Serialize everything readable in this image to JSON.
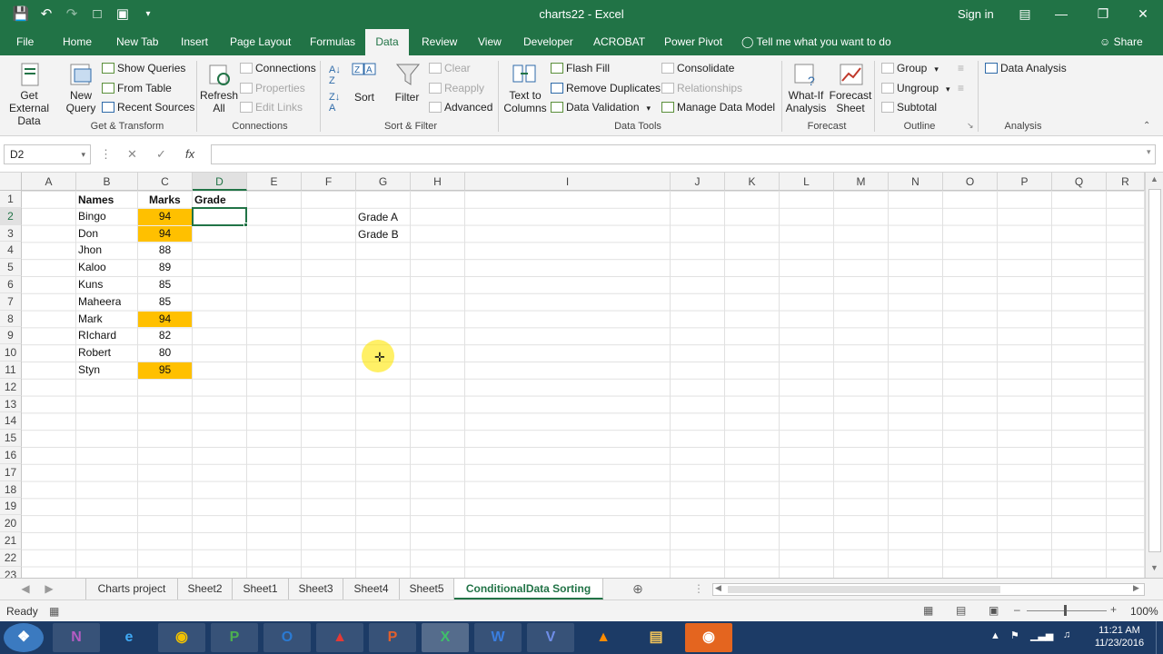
{
  "window": {
    "title": "charts22  -  Excel",
    "sign_in": "Sign in"
  },
  "ribbon_tabs": [
    {
      "label": "File"
    },
    {
      "label": "Home"
    },
    {
      "label": "New Tab"
    },
    {
      "label": "Insert"
    },
    {
      "label": "Page Layout"
    },
    {
      "label": "Formulas"
    },
    {
      "label": "Data"
    },
    {
      "label": "Review"
    },
    {
      "label": "View"
    },
    {
      "label": "Developer"
    },
    {
      "label": "ACROBAT"
    },
    {
      "label": "Power Pivot"
    }
  ],
  "active_tab": "Data",
  "tell_me": "Tell me what you want to do",
  "share": "Share",
  "ribbon": {
    "get_external_data": "Get External\nData",
    "new_query": "New\nQuery",
    "show_queries": "Show Queries",
    "from_table": "From Table",
    "recent_sources": "Recent Sources",
    "group_get_transform": "Get & Transform",
    "refresh_all": "Refresh\nAll",
    "connections": "Connections",
    "properties": "Properties",
    "edit_links": "Edit Links",
    "group_connections": "Connections",
    "sort": "Sort",
    "filter": "Filter",
    "clear": "Clear",
    "reapply": "Reapply",
    "advanced": "Advanced",
    "group_sort_filter": "Sort & Filter",
    "text_to_columns": "Text to\nColumns",
    "flash_fill": "Flash Fill",
    "remove_duplicates": "Remove Duplicates",
    "data_validation": "Data Validation",
    "consolidate": "Consolidate",
    "relationships": "Relationships",
    "manage_data_model": "Manage Data Model",
    "group_data_tools": "Data Tools",
    "what_if": "What-If\nAnalysis",
    "forecast_sheet": "Forecast\nSheet",
    "group_forecast": "Forecast",
    "group": "Group",
    "ungroup": "Ungroup",
    "subtotal": "Subtotal",
    "group_outline": "Outline",
    "data_analysis": "Data Analysis",
    "group_analysis": "Analysis"
  },
  "formula_bar": {
    "name_box": "D2",
    "fx": "fx",
    "value": ""
  },
  "columns": [
    "A",
    "B",
    "C",
    "D",
    "E",
    "F",
    "G",
    "H",
    "I",
    "J",
    "K",
    "L",
    "M",
    "N",
    "O",
    "P",
    "Q",
    "R"
  ],
  "rows": [
    "1",
    "2",
    "3",
    "4",
    "5",
    "6",
    "7",
    "8",
    "9",
    "10",
    "11",
    "12",
    "13",
    "14",
    "15",
    "16",
    "17",
    "18",
    "19",
    "20",
    "21",
    "22",
    "23"
  ],
  "table": {
    "header_names": "Names",
    "header_marks": "Marks",
    "header_grade": "Grade",
    "entries": [
      {
        "name": "Bingo",
        "marks": "94"
      },
      {
        "name": "Don",
        "marks": "94"
      },
      {
        "name": "Jhon",
        "marks": "88"
      },
      {
        "name": "Kaloo",
        "marks": "89"
      },
      {
        "name": "Kuns",
        "marks": "85"
      },
      {
        "name": "Maheera",
        "marks": "85"
      },
      {
        "name": "Mark",
        "marks": "94"
      },
      {
        "name": "RIchard",
        "marks": "82"
      },
      {
        "name": "Robert",
        "marks": "80"
      },
      {
        "name": "Styn",
        "marks": "95"
      }
    ],
    "grade_labels": [
      "Grade A",
      "Grade B"
    ],
    "highlight_color": "#ffc000"
  },
  "selected_cell": "D2",
  "sheets": [
    {
      "label": "Charts project"
    },
    {
      "label": "Sheet2"
    },
    {
      "label": "Sheet1"
    },
    {
      "label": "Sheet3"
    },
    {
      "label": "Sheet4"
    },
    {
      "label": "Sheet5"
    },
    {
      "label": "ConditionalData Sorting"
    }
  ],
  "active_sheet": "ConditionalData Sorting",
  "status": {
    "ready": "Ready",
    "zoom": "100%"
  },
  "taskbar": {
    "apps": [
      "start-orb",
      "onenote",
      "internet-explorer",
      "chrome",
      "project",
      "outlook",
      "acrobat",
      "powerpoint",
      "excel",
      "word",
      "visio",
      "vlc",
      "file-explorer",
      "recorder"
    ],
    "time": "11:21 AM",
    "date": "11/23/2016"
  },
  "colors": {
    "excel_green": "#217346",
    "taskbar": "#1c3b66"
  }
}
